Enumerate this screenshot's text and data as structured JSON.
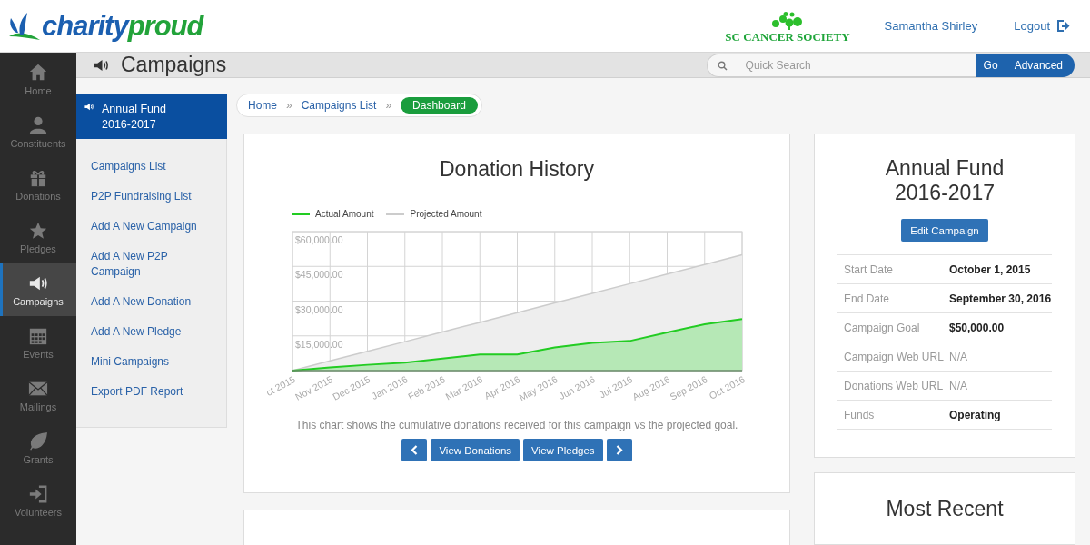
{
  "header": {
    "logo_first": "charity",
    "logo_second": "proud",
    "organization": "SC CANCER SOCIETY",
    "user": "Samantha Shirley",
    "logout": "Logout"
  },
  "nav": [
    {
      "label": "Home",
      "selected": false
    },
    {
      "label": "Constituents",
      "selected": false
    },
    {
      "label": "Donations",
      "selected": false
    },
    {
      "label": "Pledges",
      "selected": false
    },
    {
      "label": "Campaigns",
      "selected": true
    },
    {
      "label": "Events",
      "selected": false
    },
    {
      "label": "Mailings",
      "selected": false
    },
    {
      "label": "Grants",
      "selected": false
    },
    {
      "label": "Volunteers",
      "selected": false
    }
  ],
  "title_bar": {
    "title": "Campaigns",
    "search": {
      "placeholder": "Quick Search"
    },
    "go": "Go",
    "advanced": "Advanced"
  },
  "submenu": {
    "title": "Annual Fund 2016-2017",
    "items": [
      {
        "label": "Campaigns List"
      },
      {
        "label": "P2P Fundraising List"
      },
      {
        "label": "Add A New Campaign"
      },
      {
        "label": "Add A New P2P Campaign"
      },
      {
        "label": "Add A New Donation"
      },
      {
        "label": "Add A New Pledge"
      },
      {
        "label": "Mini Campaigns"
      },
      {
        "label": "Export PDF Report"
      }
    ]
  },
  "breadcrumb": {
    "separator": "»",
    "items": [
      {
        "label": "Home",
        "selected": false
      },
      {
        "label": "Campaigns List",
        "selected": false
      },
      {
        "label": "Dashboard",
        "selected": true
      }
    ]
  },
  "chart_card": {
    "title": "Donation History",
    "chart_data": {
      "type": "area",
      "categories": [
        "ct 2015",
        "Nov 2015",
        "Dec 2015",
        "Jan 2016",
        "Feb 2016",
        "Mar 2016",
        "Apr 2016",
        "May 2016",
        "Jun 2016",
        "Jul 2016",
        "Aug 2016",
        "Sep 2016",
        "Oct 2016"
      ],
      "series": [
        {
          "name": "Actual Amount",
          "color": "#22cc22",
          "values": [
            0,
            1400,
            2500,
            3400,
            5200,
            7000,
            7000,
            10000,
            12000,
            12800,
            16500,
            20000,
            22300
          ]
        },
        {
          "name": "Projected Amount",
          "color": "#cccccc",
          "values": [
            0,
            4200,
            8300,
            12500,
            16700,
            20800,
            25000,
            29200,
            33300,
            37500,
            41700,
            45800,
            50000
          ]
        }
      ],
      "ylim": [
        0,
        60000
      ],
      "grid": true,
      "yticks": [
        {
          "value": 15000,
          "label": "$15,000.00"
        },
        {
          "value": 30000,
          "label": "$30,000.00"
        },
        {
          "value": 45000,
          "label": "$45,000.00"
        },
        {
          "value": 60000,
          "label": "$60,000.00"
        }
      ]
    },
    "caption": "This chart shows the cumulative donations received for this campaign vs the projected goal.",
    "buttons": [
      {
        "kind": "prev"
      },
      {
        "kind": "text",
        "label": "View Donations"
      },
      {
        "kind": "text",
        "label": "View Pledges"
      },
      {
        "kind": "next"
      }
    ]
  },
  "info_card": {
    "title": "Annual Fund 2016-2017",
    "edit_button": "Edit Campaign",
    "rows": [
      {
        "label": "Start Date",
        "value": "October 1, 2015",
        "emphasis": true
      },
      {
        "label": "End Date",
        "value": "September 30, 2016",
        "emphasis": true
      },
      {
        "label": "Campaign Goal",
        "value": "$50,000.00",
        "emphasis": true
      },
      {
        "label": "Campaign Web URL",
        "value": "N/A",
        "emphasis": false
      },
      {
        "label": "Donations Web URL",
        "value": "N/A",
        "emphasis": false
      },
      {
        "label": "Funds",
        "value": "Operating",
        "emphasis": true
      }
    ]
  },
  "recent_card": {
    "title": "Most Recent"
  }
}
